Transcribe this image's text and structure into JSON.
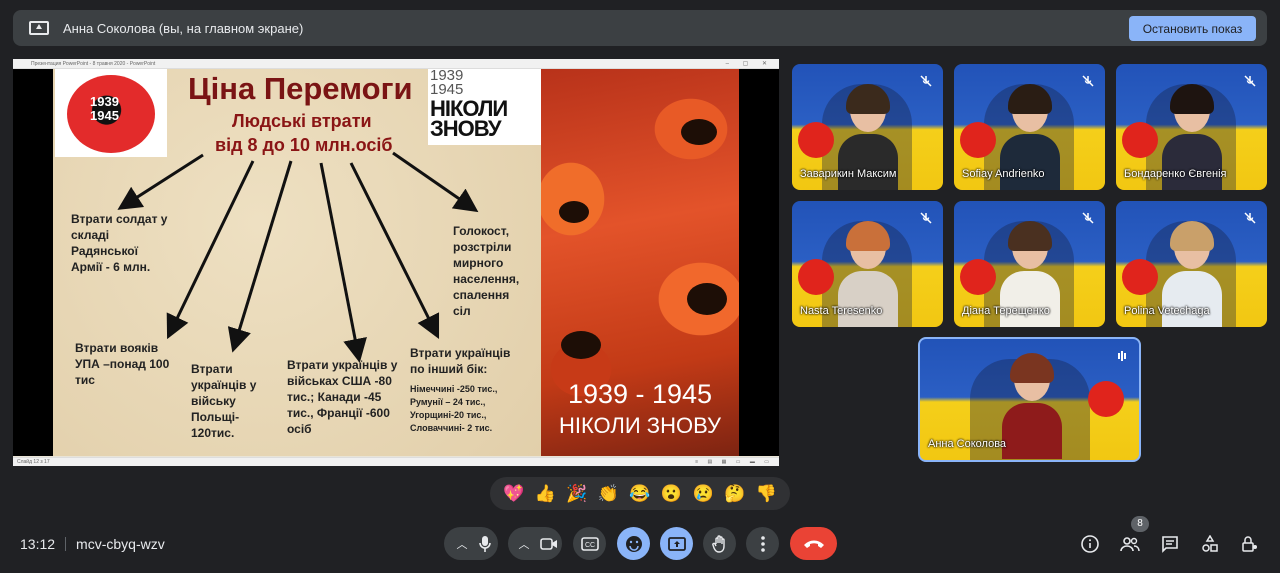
{
  "banner": {
    "title": "Анна Соколова (вы, на главном экране)",
    "stop_label": "Остановить показ"
  },
  "powerpoint": {
    "window_title": "Презентация PowerPoint - 8 травня 2020 - PowerPoint",
    "status": "Слайд 12 з 17"
  },
  "slide": {
    "logo_years": [
      "1939",
      "1945"
    ],
    "title": "Ціна Перемоги",
    "subtitle1": "Людські втрати",
    "subtitle2": "від 8 до 10 млн.осіб",
    "nikoly_years": [
      "1939",
      "1945"
    ],
    "nikoly_words": [
      "НІКОЛИ",
      "ЗНОВУ"
    ],
    "poppy_years": "1939 - 1945",
    "poppy_sub": "НІКОЛИ ЗНОВУ",
    "blocks": {
      "soldiers": [
        "Втрати солдат у",
        "складі",
        "Радянської",
        "Армії - 6 млн."
      ],
      "holocaust": [
        "Голокост,",
        "розстріли",
        "мирного",
        "населення,",
        "спалення",
        "сіл"
      ],
      "upa": [
        "Втрати вояків",
        "УПА –понад 100",
        "тис"
      ],
      "poland": [
        "Втрати",
        "українців у",
        "війську",
        "Польщі-",
        "120тис."
      ],
      "usa": [
        "Втрати українців у",
        "військах США -80",
        "тис.; Канади -45",
        "тис., Франції -600",
        "осіб"
      ],
      "other_side": [
        "Втрати українців",
        "по інший бік:"
      ],
      "other_list": [
        "Німеччині -250 тис.,",
        "Румунії – 24 тис.,",
        "Угорщині-20 тис.,",
        "Словаччині- 2 тис."
      ]
    }
  },
  "participants": [
    {
      "name": "Заварикин Максим",
      "hair": "#3b2a1c",
      "shirt": "#2a2a2a"
    },
    {
      "name": "Sofiay Andrienko",
      "hair": "#2a1d14",
      "shirt": "#1e2a3a"
    },
    {
      "name": "Бондаренко Євгенія",
      "hair": "#1e1410",
      "shirt": "#2b2b3a"
    },
    {
      "name": "Nasta Teresenko",
      "hair": "#c9703a",
      "shirt": "#d8d0c6"
    },
    {
      "name": "Діана Терещенко",
      "hair": "#4a3020",
      "shirt": "#f1efe8"
    },
    {
      "name": "Polina Vetechaga",
      "hair": "#c9a06a",
      "shirt": "#e6ebf0"
    }
  ],
  "presenter": {
    "name": "Анна Соколова",
    "hair": "#7a3520",
    "shirt": "#8e1b1b"
  },
  "reactions": [
    "💖",
    "👍",
    "🎉",
    "👏",
    "😂",
    "😮",
    "😢",
    "🤔",
    "👎"
  ],
  "footer": {
    "time": "13:12",
    "meeting_code": "mcv-cbyq-wzv",
    "people_count": "8"
  }
}
